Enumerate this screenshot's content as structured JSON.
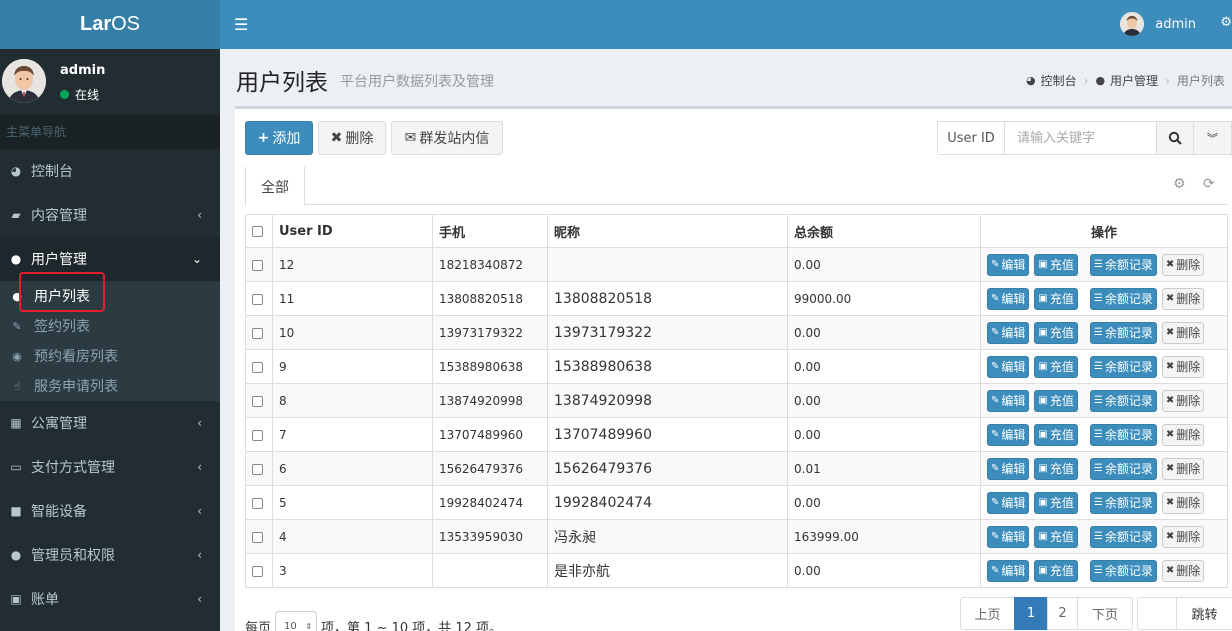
{
  "app": {
    "logo_bold": "Lar",
    "logo_light": "OS"
  },
  "sidebar": {
    "user": {
      "name": "admin",
      "status": "在线"
    },
    "header": "主菜单导航",
    "items": [
      {
        "label": "控制台",
        "icon": "dashboard-icon"
      },
      {
        "label": "内容管理",
        "icon": "book-icon"
      },
      {
        "label": "用户管理",
        "icon": "users-icon"
      },
      {
        "label": "公寓管理",
        "icon": "building-icon"
      },
      {
        "label": "支付方式管理",
        "icon": "credit-card-icon"
      },
      {
        "label": "智能设备",
        "icon": "lock-icon"
      },
      {
        "label": "管理员和权限",
        "icon": "user-icon"
      },
      {
        "label": "账单",
        "icon": "money-icon"
      }
    ],
    "subitems": [
      {
        "label": "用户列表",
        "icon": "user-icon"
      },
      {
        "label": "签约列表",
        "icon": "edit-icon"
      },
      {
        "label": "预约看房列表",
        "icon": "eye-icon"
      },
      {
        "label": "服务申请列表",
        "icon": "hand-icon"
      }
    ]
  },
  "topbar": {
    "user": "admin"
  },
  "page": {
    "title": "用户列表",
    "subtitle": "平台用户数据列表及管理",
    "breadcrumb": [
      "控制台",
      "用户管理",
      "用户列表"
    ]
  },
  "toolbar": {
    "add": "添加",
    "delete": "删除",
    "message": "群发站内信"
  },
  "search": {
    "label": "User ID",
    "placeholder": "请输入关键字"
  },
  "tabs": [
    "全部"
  ],
  "table": {
    "headers": [
      "User ID",
      "手机",
      "昵称",
      "总余额",
      "操作"
    ],
    "actions": {
      "edit": "编辑",
      "recharge": "充值",
      "balance": "余额记录",
      "delete": "删除"
    },
    "rows": [
      {
        "id": "12",
        "phone": "18218340872",
        "nick": "",
        "balance": "0.00"
      },
      {
        "id": "11",
        "phone": "13808820518",
        "nick": "13808820518",
        "balance": "99000.00"
      },
      {
        "id": "10",
        "phone": "13973179322",
        "nick": "13973179322",
        "balance": "0.00"
      },
      {
        "id": "9",
        "phone": "15388980638",
        "nick": "15388980638",
        "balance": "0.00"
      },
      {
        "id": "8",
        "phone": "13874920998",
        "nick": "13874920998",
        "balance": "0.00"
      },
      {
        "id": "7",
        "phone": "13707489960",
        "nick": "13707489960",
        "balance": "0.00"
      },
      {
        "id": "6",
        "phone": "15626479376",
        "nick": "15626479376",
        "balance": "0.01"
      },
      {
        "id": "5",
        "phone": "19928402474",
        "nick": "19928402474",
        "balance": "0.00"
      },
      {
        "id": "4",
        "phone": "13533959030",
        "nick": "冯永昶",
        "balance": "163999.00"
      },
      {
        "id": "3",
        "phone": "",
        "nick": "是非亦航",
        "balance": "0.00"
      }
    ]
  },
  "pager": {
    "prefix": "每页",
    "size": "10",
    "suffix": "项，第 1 ~ 10 项，共 12 项。",
    "prev": "上页",
    "pages": [
      "1",
      "2"
    ],
    "next": "下页",
    "go": "跳转"
  },
  "colors": {
    "primary": "#3c8dbc",
    "sidebar": "#222d32",
    "highlight": "#e0202e"
  }
}
